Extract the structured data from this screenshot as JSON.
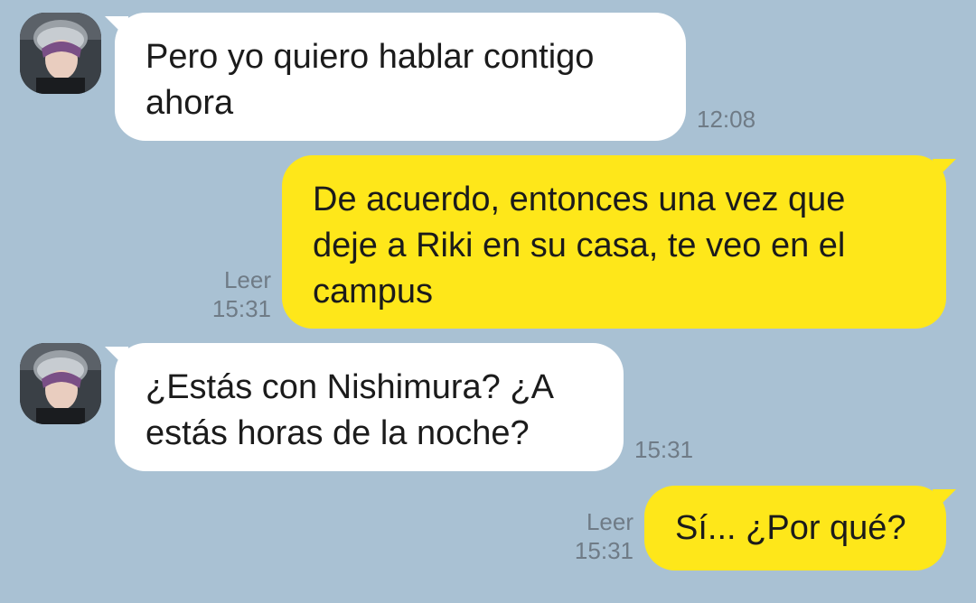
{
  "messages": [
    {
      "direction": "incoming",
      "lines": [
        "Pero yo quiero hablar contigo",
        "ahora"
      ],
      "time": "12:08"
    },
    {
      "direction": "outgoing",
      "lines": [
        "De acuerdo, entonces una vez que",
        "deje a Riki en su casa, te veo en el",
        "campus"
      ],
      "read": "Leer",
      "time": "15:31"
    },
    {
      "direction": "incoming",
      "lines": [
        "¿Estás con Nishimura? ¿A",
        "estás horas de la noche?"
      ],
      "time": "15:31"
    },
    {
      "direction": "outgoing",
      "lines": [
        "Sí... ¿Por qué?"
      ],
      "read": "Leer",
      "time": "15:31"
    }
  ],
  "colors": {
    "background": "#a9c1d3",
    "incoming_bubble": "#ffffff",
    "outgoing_bubble": "#fee71a",
    "meta_text": "#6f7b86"
  },
  "icons": {
    "avatar": "profile-photo-avatar"
  }
}
